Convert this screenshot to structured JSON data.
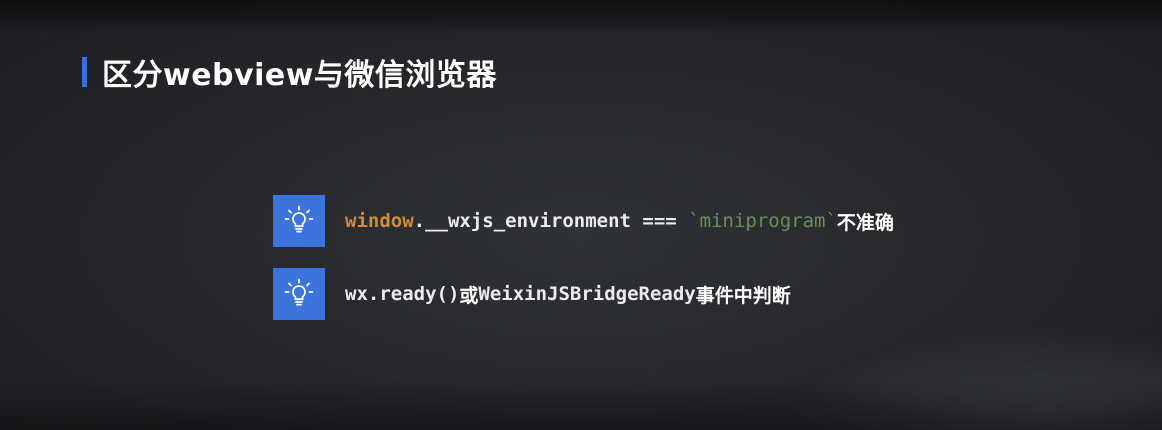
{
  "slide": {
    "title": "区分webview与微信浏览器",
    "accent_color": "#3b6fe0",
    "background_color": "#26282c"
  },
  "items": [
    {
      "icon": "lightbulb-icon",
      "code_keyword": "window",
      "code_rest": ".__wxjs_environment === ",
      "code_string": "`miniprogram`",
      "note": "不准确"
    },
    {
      "icon": "lightbulb-icon",
      "code_a": "wx.ready()",
      "conj": " 或 ",
      "code_b": "WeixinJSBridgeReady",
      "note": " 事件中判断"
    }
  ],
  "colors": {
    "icon_box": "#3c73dc",
    "keyword": "#d48a3c",
    "string": "#6b8f5a",
    "text": "#e9ebef"
  }
}
